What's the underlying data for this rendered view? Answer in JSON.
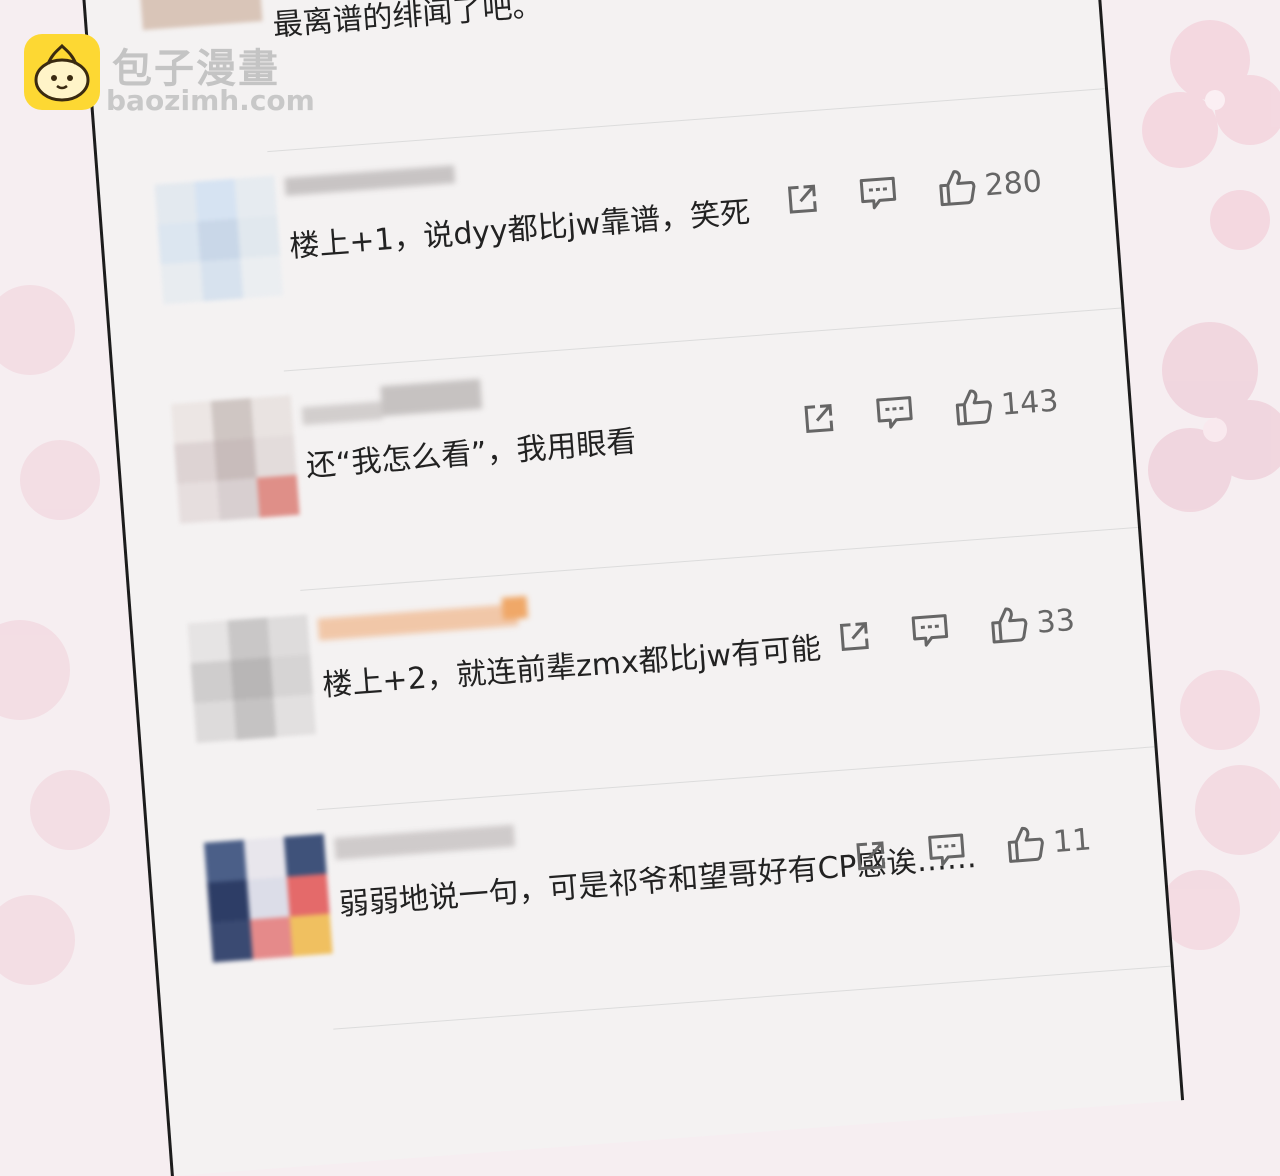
{
  "watermark": {
    "title": "包子漫畫",
    "url": "baozimh.com"
  },
  "top_comment": {
    "text": "最离谱的绯闻了吧。"
  },
  "comments": [
    {
      "text": "楼上+1，说dyy都比jw靠谱，笑死",
      "likes": "280"
    },
    {
      "text": "还“我怎么看”，我用眼看",
      "likes": "143"
    },
    {
      "text": "楼上+2，就连前辈zmx都比jw有可能",
      "likes": "33"
    },
    {
      "text": "弱弱地说一句，可是祁爷和望哥好有CP感诶……",
      "likes": "11"
    }
  ],
  "icons": [
    "share-icon",
    "comment-icon",
    "like-icon",
    "logo-icon"
  ],
  "colors": {
    "panel": "#f4f2f2",
    "frame": "#1c1c1c",
    "icon": "#666666",
    "logo": "#fdd833",
    "background": "#f6eef1"
  }
}
